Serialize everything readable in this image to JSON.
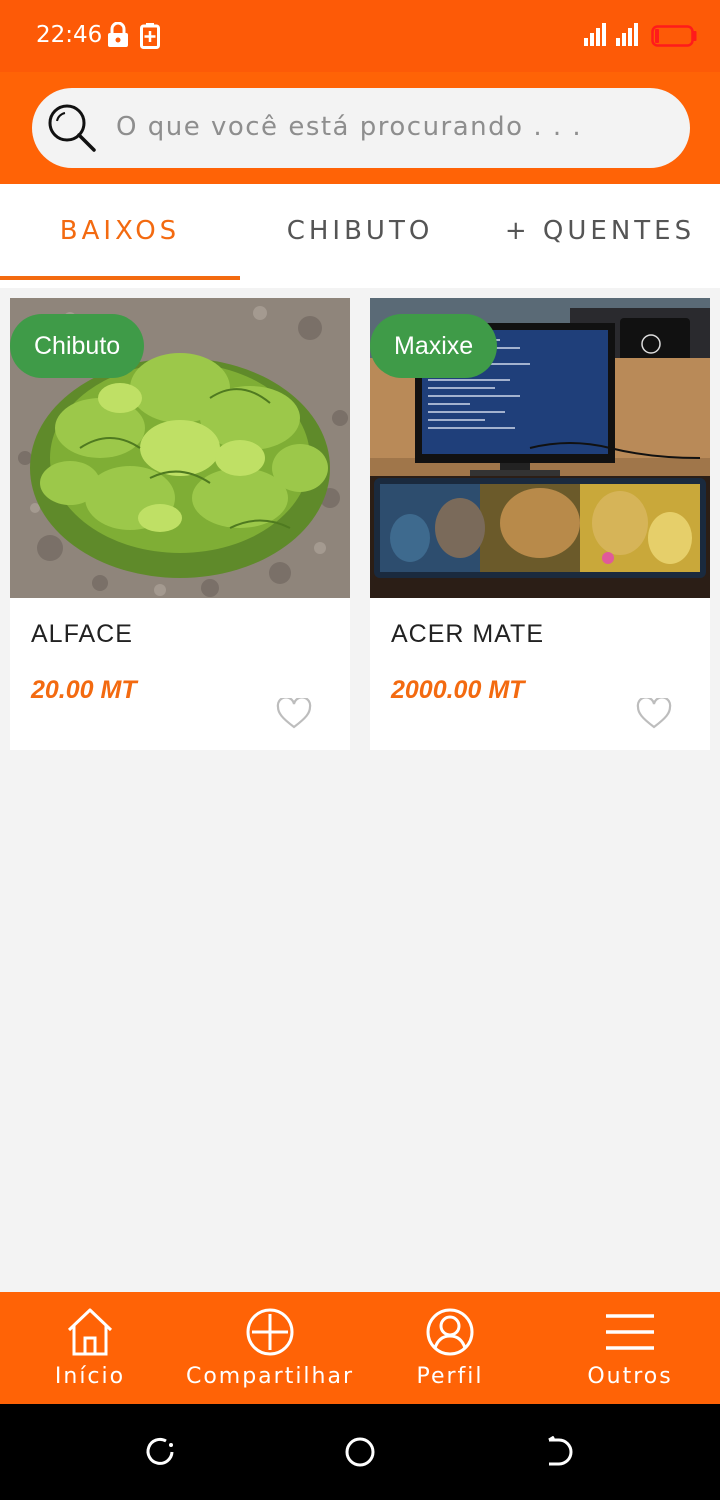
{
  "status_bar": {
    "time": "22:46",
    "icons": [
      "lock-icon",
      "battery-saver-icon",
      "signal-icon",
      "battery-icon"
    ]
  },
  "search": {
    "placeholder": "O que você está procurando . . ."
  },
  "tabs": [
    {
      "label": "BAIXOS",
      "active": true
    },
    {
      "label": "CHIBUTO",
      "active": false
    },
    {
      "label": "+ QUENTES",
      "active": false
    }
  ],
  "products": [
    {
      "location": "Chibuto",
      "title": "ALFACE",
      "price": "20.00 MT",
      "image": "lettuce-photo"
    },
    {
      "location": "Maxixe",
      "title": "ACER MATE",
      "price": "2000.00 MT",
      "image": "computer-desk-photo"
    }
  ],
  "bottom_nav": [
    {
      "label": "Início",
      "icon": "home-icon"
    },
    {
      "label": "Compartilhar",
      "icon": "plus-circle-icon"
    },
    {
      "label": "Perfil",
      "icon": "profile-icon"
    },
    {
      "label": "Outros",
      "icon": "menu-icon"
    }
  ],
  "colors": {
    "primary": "#ff6306",
    "accent": "#f36a10",
    "badge": "#3f9b48",
    "background": "#f3f3f3"
  }
}
